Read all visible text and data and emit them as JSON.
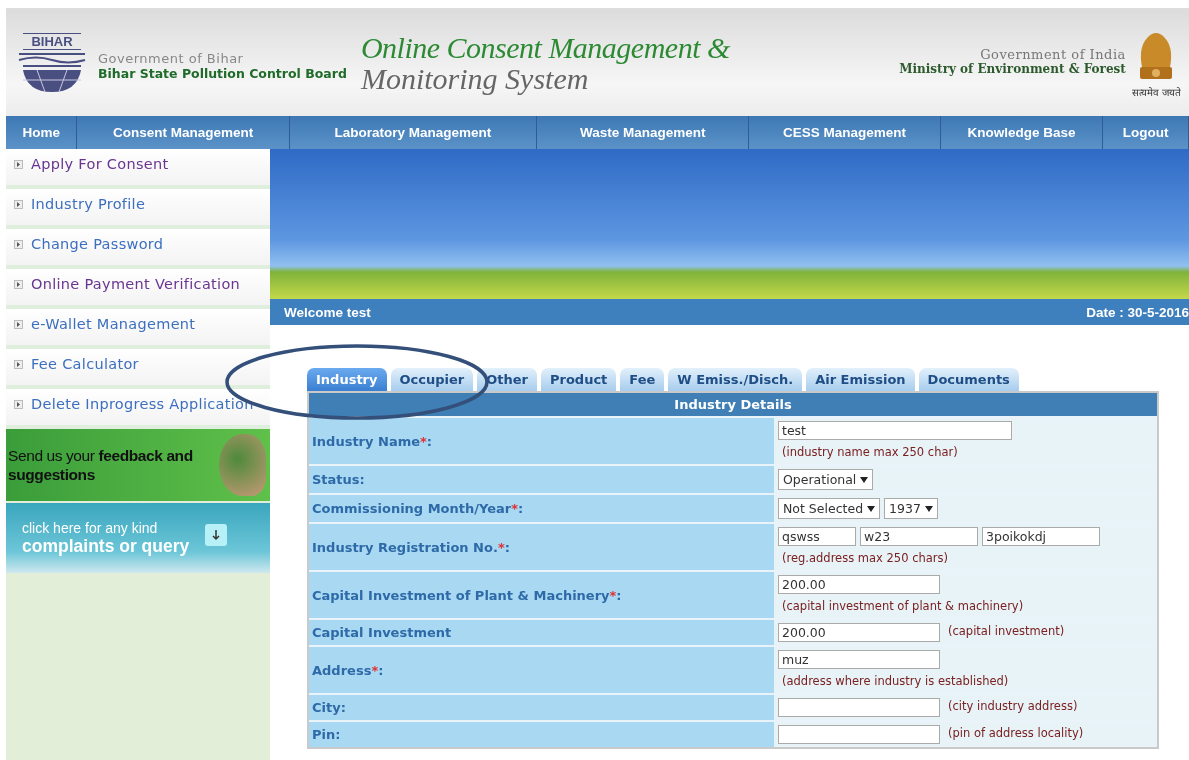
{
  "header": {
    "state_logo_text": "BIHAR",
    "gov_line": "Government of Bihar",
    "board_name": "Bihar State Pollution Control Board",
    "title_line1": "Online Consent Management &",
    "title_line2": "Monitoring System",
    "india_line": "Government of India",
    "ministry": "Ministry of Environment & Forest",
    "motto": "सत्यमेव जयते"
  },
  "nav": [
    {
      "label": "Home"
    },
    {
      "label": "Consent Management"
    },
    {
      "label": "Laboratory Management"
    },
    {
      "label": "Waste Management"
    },
    {
      "label": "CESS Management"
    },
    {
      "label": "Knowledge Base"
    },
    {
      "label": "Logout"
    }
  ],
  "sidebar": {
    "items": [
      {
        "label": "Apply For Consent",
        "visited": true
      },
      {
        "label": "Industry Profile",
        "visited": false
      },
      {
        "label": "Change Password",
        "visited": false
      },
      {
        "label": "Online Payment Verification",
        "visited": true
      },
      {
        "label": "e-Wallet Management",
        "visited": false
      },
      {
        "label": "Fee Calculator",
        "visited": false
      },
      {
        "label": "Delete Inprogress Application",
        "visited": false
      }
    ],
    "feedback": "Send us your **feedback** **and suggestions**",
    "complaint_small": "click here for any kind",
    "complaint_big": "complaints or query"
  },
  "welcome": "Welcome test",
  "date": "Date : 30-5-2016",
  "tabs": [
    {
      "label": "Industry",
      "selected": true
    },
    {
      "label": "Occupier",
      "selected": false
    },
    {
      "label": "Other",
      "selected": false
    },
    {
      "label": "Product",
      "selected": false
    },
    {
      "label": "Fee",
      "selected": false
    },
    {
      "label": "W Emiss./Disch.",
      "selected": false
    },
    {
      "label": "Air Emission",
      "selected": false
    },
    {
      "label": "Documents",
      "selected": false
    }
  ],
  "form": {
    "title": "Industry Details",
    "rows": [
      {
        "label": "Industry Name",
        "mark": "*",
        "colon": ":",
        "fields": [
          {
            "kind": "wide-input",
            "value": "test"
          }
        ],
        "hint": "(industry name max 250 char)"
      },
      {
        "label": "Status",
        "colon": ":",
        "fields": [
          {
            "kind": "select",
            "value": "Operational"
          }
        ]
      },
      {
        "label": "Commissioning Month/Year",
        "mark": "*",
        "colon": ":",
        "fields": [
          {
            "kind": "select",
            "value": "Not Selected"
          },
          {
            "kind": "select",
            "value": "1937"
          }
        ]
      },
      {
        "label": "Industry Registration No.",
        "mark": "*",
        "colon": ":",
        "fields": [
          {
            "kind": "short-input",
            "value": "qswss"
          },
          {
            "kind": "mid-input",
            "value": "w23"
          },
          {
            "kind": "mid-input",
            "value": "3poikokdj"
          }
        ],
        "hint": "(reg.address max 250 chars)"
      },
      {
        "label": "Capital Investment of Plant & Machinery",
        "mark": "*",
        "colon": ":",
        "fields": [
          {
            "kind": "input",
            "value": "200.00"
          }
        ],
        "hint": "(capital investment of plant & machinery)"
      },
      {
        "label": "Capital Investment",
        "fields": [
          {
            "kind": "input",
            "value": "200.00"
          }
        ],
        "hint": "(capital investment)"
      },
      {
        "label": "Address",
        "mark": "*",
        "colon": ":",
        "fields": [
          {
            "kind": "input",
            "value": "muz"
          }
        ],
        "hint": "(address where industry is established)"
      },
      {
        "label": "City",
        "colon": ":",
        "fields": [
          {
            "kind": "input"
          }
        ],
        "hint": "(city industry address)"
      },
      {
        "label": "Pin",
        "colon": ":",
        "fields": [
          {
            "kind": "input"
          }
        ],
        "hint": "(pin of address locality)"
      }
    ]
  }
}
